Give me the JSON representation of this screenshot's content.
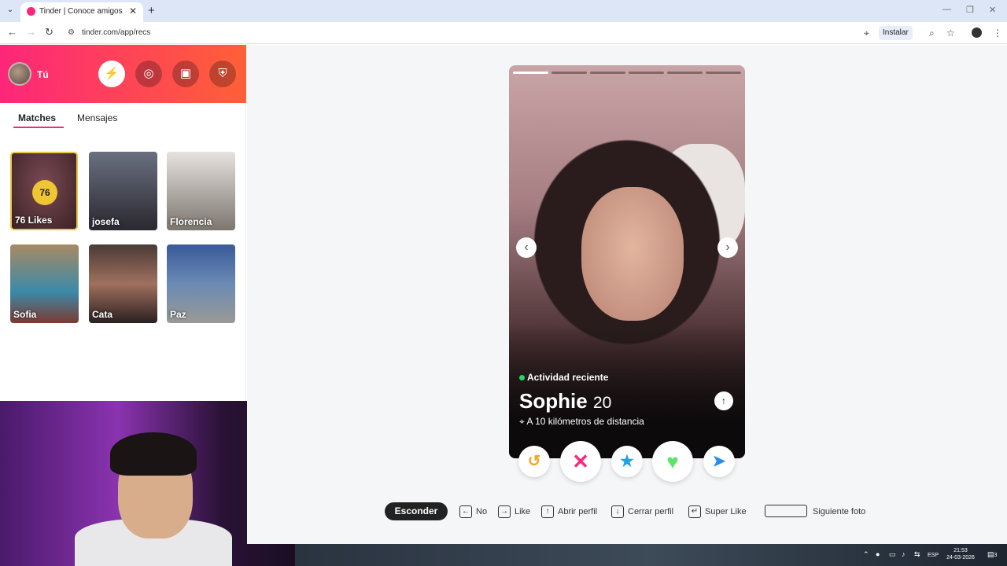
{
  "browser": {
    "tab_title": "Tinder | Conoce amigos y gente",
    "url": "tinder.com/app/recs",
    "install_label": "Instalar"
  },
  "sidebar": {
    "user_label": "Tú",
    "tabs": [
      "Matches",
      "Mensajes"
    ],
    "likes_count": "76",
    "likes_label": "76 Likes",
    "matches": [
      "josefa",
      "Florencia",
      "Sofia",
      "Cata",
      "Paz"
    ]
  },
  "profile": {
    "activity": "Actividad reciente",
    "name": "Sophie",
    "age": "20",
    "distance": "A 10 kilómetros de distancia",
    "photo_count": 6,
    "active_photo": 1
  },
  "hints": {
    "hide": "Esconder",
    "no": "No",
    "like": "Like",
    "open_profile": "Abrir perfil",
    "close_profile": "Cerrar perfil",
    "super_like": "Super Like",
    "next_photo": "Siguiente foto"
  },
  "taskbar": {
    "language": "ESP",
    "time": "21:53",
    "date": "24-03-2026",
    "notifications": "3"
  },
  "colors": {
    "brand_start": "#fd267a",
    "brand_end": "#ff6036",
    "nope": "#fd267a",
    "like": "#5fe36a",
    "super": "#1ea2e8",
    "rewind": "#f5a623",
    "boost": "#2a8ce6"
  }
}
